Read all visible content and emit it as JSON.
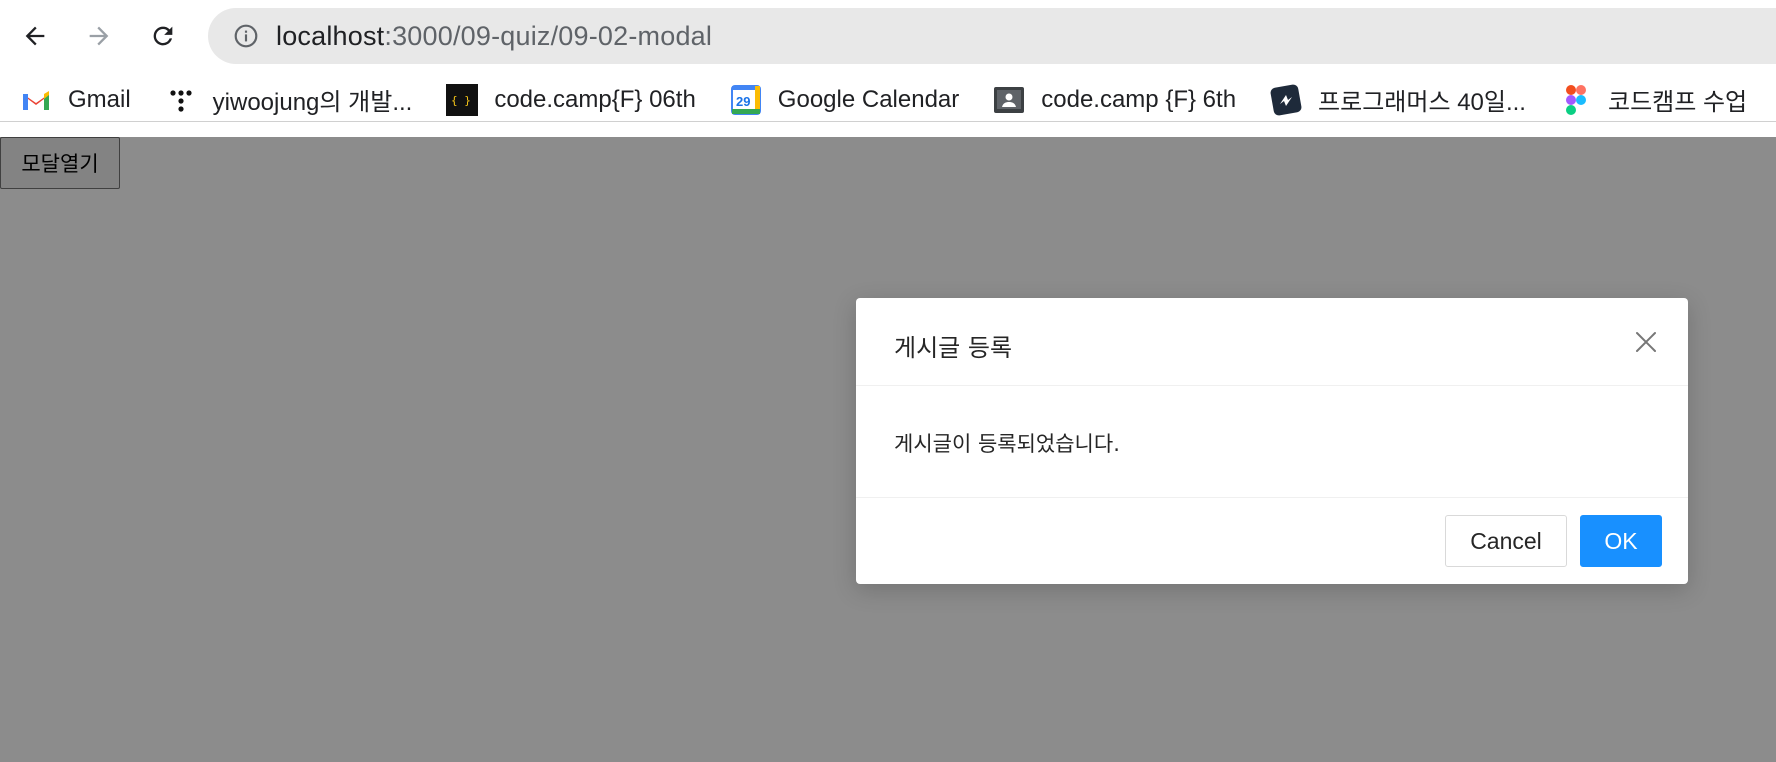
{
  "browser": {
    "url_host": "localhost",
    "url_path": ":3000/09-quiz/09-02-modal"
  },
  "bookmarks": [
    {
      "label": "Gmail",
      "icon": "gmail-icon"
    },
    {
      "label": "yiwoojung의 개발...",
      "icon": "dots-icon"
    },
    {
      "label": "code.camp{F} 06th",
      "icon": "codecamp-icon"
    },
    {
      "label": "Google Calendar",
      "icon": "calendar-icon",
      "icon_text": "29"
    },
    {
      "label": "code.camp {F} 6th",
      "icon": "classroom-icon"
    },
    {
      "label": "프로그래머스 40일...",
      "icon": "programmers-icon"
    },
    {
      "label": "코드캠프 수업",
      "icon": "figma-icon"
    }
  ],
  "page": {
    "open_button_label": "모달열기"
  },
  "modal": {
    "title": "게시글 등록",
    "body": "게시글이 등록되었습니다.",
    "cancel_label": "Cancel",
    "ok_label": "OK"
  },
  "colors": {
    "primary": "#1890ff",
    "mask": "rgba(0,0,0,0.45)"
  }
}
